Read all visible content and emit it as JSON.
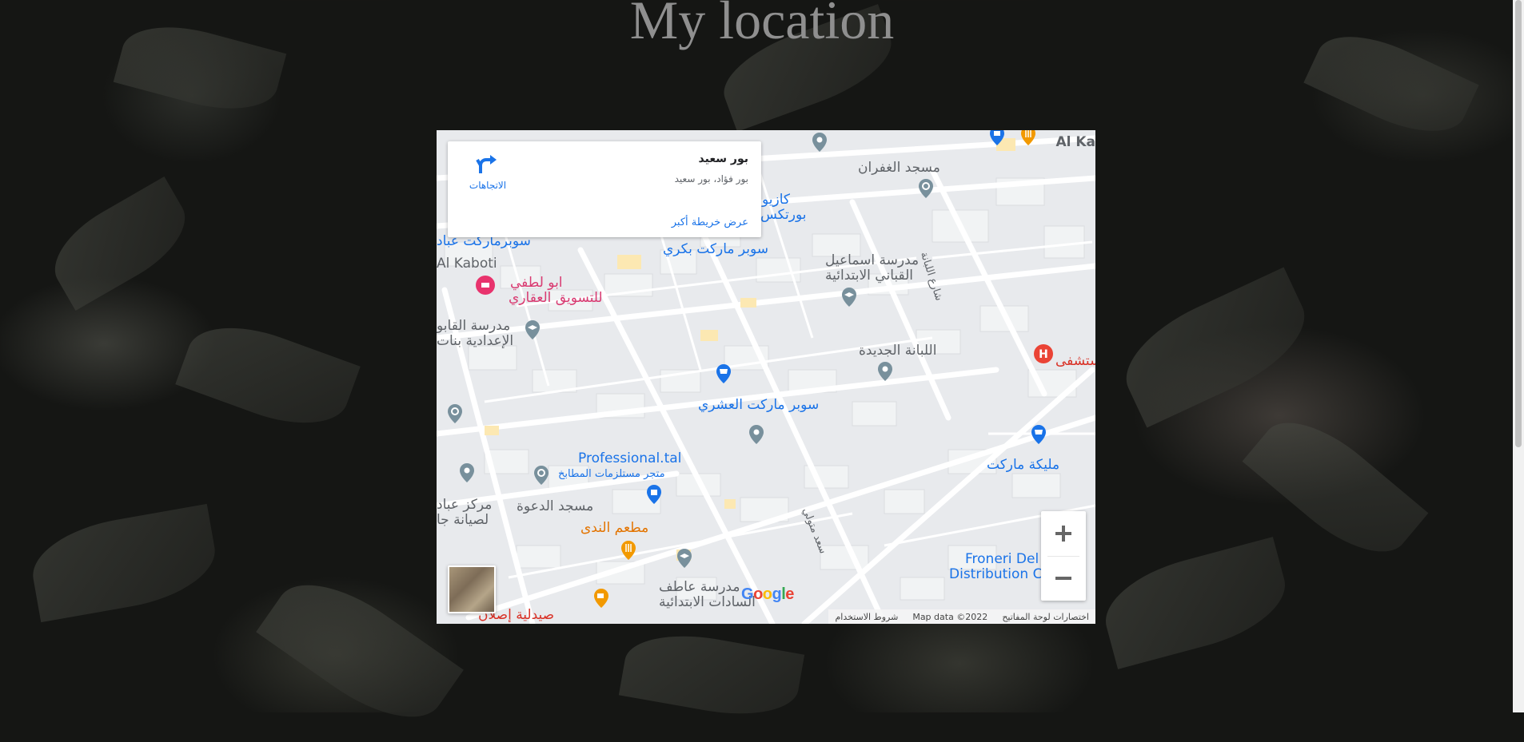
{
  "page": {
    "title": "My location"
  },
  "map": {
    "info_card": {
      "place_name": "بور سعيد",
      "address": "بور فؤاد، بور سعيد",
      "directions_label": "الاتجاهات",
      "view_larger_label": "عرض خريطة أكبر"
    },
    "labels": {
      "al_ka": "Al Ka",
      "mosque_ghofran": "مسجد الغفران",
      "kazyoni": "كازيو",
      "bortex": "بورتكس",
      "super_market_bakry": "سوبر ماركت بكري",
      "supermarket_abbad": "سوبرماركت عباد",
      "al_kaboti": "Al Kaboti",
      "abu_lotfy_1": "ابو لطفي",
      "abu_lotfy_2": "للتسويق العقاري",
      "school_qaboti_1": "مدرسة القابو",
      "school_qaboti_2": "الإعدادية بنات",
      "school_ismail_1": "مدرسة اسماعيل",
      "school_ismail_2": "القباني الابتدائية",
      "street_labana": "شارع اللبانة",
      "labana_new": "اللبانة الجديدة",
      "hospital": "مستشفى",
      "super_ashry": "سوبر ماركت العشري",
      "professional_1": "Professional.tal",
      "professional_2": "متجر مستلزمات المطابخ",
      "malika_market": "مليكة ماركت",
      "markaz_abbad_1": "مركز عباد",
      "markaz_abbad_2": "لصيانة جا",
      "mosque_dawa": "مسجد الدعوة",
      "restaurant_nada": "مطعم الندى",
      "street_saad": "سعد متولي",
      "froneri_1": "Froneri Del",
      "froneri_2": "Distribution C",
      "school_atef_1": "مدرسة عاطف",
      "school_atef_2": "السادات الابتدائية",
      "pharmacy": "صيدلية إصلان"
    },
    "controls": {
      "zoom_in": "+",
      "zoom_out": "−"
    },
    "footer": {
      "shortcuts": "اختصارات لوحة المفاتيح",
      "map_data": "Map data ©2022",
      "terms": "شروط الاستخدام"
    },
    "google_logo": [
      "G",
      "o",
      "o",
      "g",
      "l",
      "e"
    ],
    "colors": {
      "blue": "#1a73e8",
      "pink": "#d93a71",
      "orange": "#e37400",
      "red": "#d93025",
      "gray_pin": "#78909c"
    }
  }
}
